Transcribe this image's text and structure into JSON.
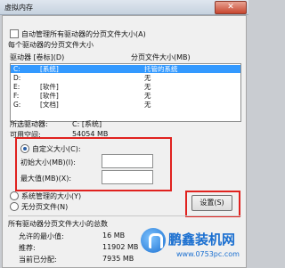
{
  "window": {
    "title": "虚拟内存",
    "close_label": "✕"
  },
  "auto_manage": {
    "label": "自动管理所有驱动器的分页文件大小(A)",
    "checked": false
  },
  "list": {
    "group_label": "每个驱动器的分页文件大小",
    "col_drive": "驱动器 [卷标](D)",
    "col_size": "分页文件大小(MB)",
    "rows": [
      {
        "drive": "C:",
        "label": "[系统]",
        "size": "托管的系统",
        "selected": true
      },
      {
        "drive": "D:",
        "label": "",
        "size": "无",
        "selected": false
      },
      {
        "drive": "E:",
        "label": "[软件]",
        "size": "无",
        "selected": false
      },
      {
        "drive": "F:",
        "label": "[软件]",
        "size": "无",
        "selected": false
      },
      {
        "drive": "G:",
        "label": "[文档]",
        "size": "无",
        "selected": false
      }
    ]
  },
  "info": {
    "drive_label": "所选驱动器:",
    "drive_value": "C:  [系统]",
    "space_label": "可用空间:",
    "space_value": "54054 MB"
  },
  "options": {
    "custom_label": "自定义大小(C):",
    "initial_label": "初始大小(MB)(I):",
    "initial_value": "",
    "max_label": "最大值(MB)(X):",
    "max_value": "",
    "system_managed_label": "系统管理的大小(Y)",
    "no_paging_label": "无分页文件(N)",
    "selected": "custom"
  },
  "set_button": {
    "label": "设置(S)"
  },
  "totals": {
    "group_label": "所有驱动器分页文件大小的总数",
    "min_label": "允许的最小值:",
    "min_value": "16 MB",
    "recommended_label": "推荐:",
    "recommended_value": "11902 MB",
    "current_label": "当前已分配:",
    "current_value": "7935 MB"
  },
  "watermark": {
    "brand": "鹏鑫装机网",
    "url": "www.0753pc.com"
  },
  "colors": {
    "highlight": "#e0221f",
    "selection": "#3399ff",
    "brand": "#1a6fd0"
  }
}
